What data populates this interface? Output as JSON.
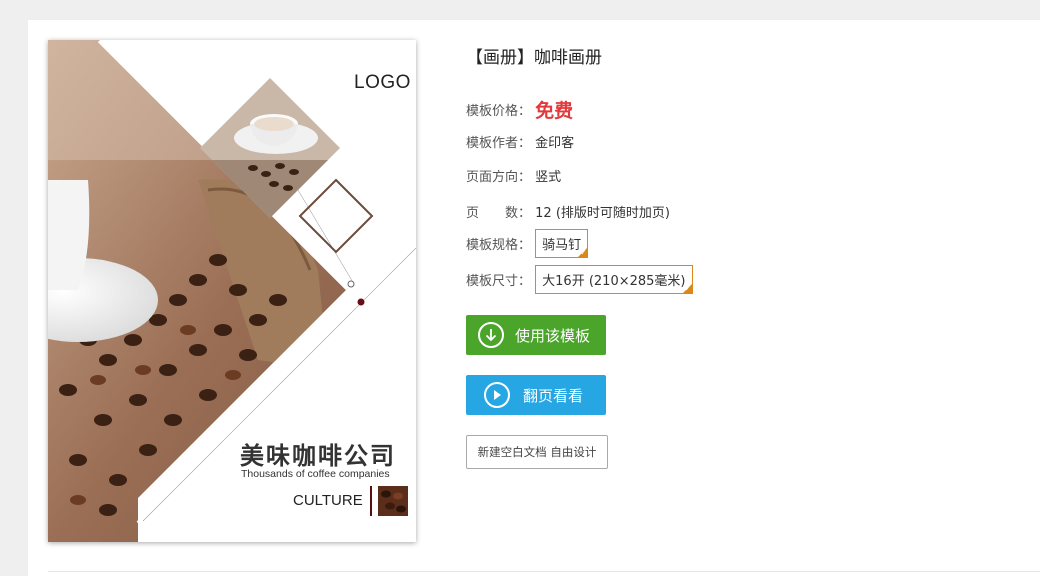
{
  "cover": {
    "logo": "LOGO",
    "title": "美味咖啡公司",
    "subtitle": "Thousands of coffee companies",
    "culture": "CULTURE"
  },
  "info": {
    "title": "【画册】咖啡画册",
    "price_label": "模板价格：",
    "price_value": "免费",
    "author_label": "模板作者：",
    "author_value": "金印客",
    "orientation_label": "页面方向：",
    "orientation_value": "竖式",
    "pages_label": "页　　数：",
    "pages_value": "12 (排版时可随时加页)",
    "spec_label": "模板规格：",
    "spec_value": "骑马钉",
    "size_label": "模板尺寸：",
    "size_value": "大16开 (210×285毫米)"
  },
  "actions": {
    "use_template": "使用该模板",
    "flip_preview": "翻页看看",
    "new_blank": "新建空白文档 自由设计"
  },
  "colors": {
    "price": "#e4393c",
    "green_button": "#4aa52a",
    "blue_button": "#26a7e3",
    "tag_border": "#d8891a"
  }
}
